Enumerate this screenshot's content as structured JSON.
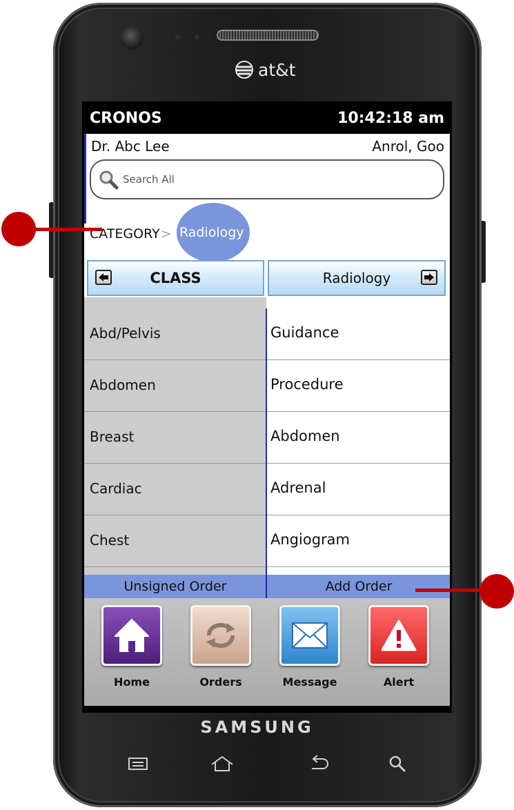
{
  "device": {
    "carrier": "at&t",
    "brand": "SAMSUNG"
  },
  "status_bar": {
    "app_name": "CRONOS",
    "time": "10:42:18 am"
  },
  "header": {
    "doctor": "Dr. Abc Lee",
    "patient": "Anrol, Goo"
  },
  "search": {
    "placeholder": "Search All"
  },
  "breadcrumb": {
    "root": "CATEGORY",
    "separator": ">",
    "current": "Radiology"
  },
  "columns": {
    "left_title": "CLASS",
    "right_title": "Radiology"
  },
  "class_list": [
    "Abd/Pelvis",
    "Abdomen",
    "Breast",
    "Cardiac",
    "Chest"
  ],
  "radiology_list": [
    "Guidance",
    "Procedure",
    "Abdomen",
    "Adrenal",
    "Angiogram"
  ],
  "actions": {
    "unsigned_order": "Unsigned Order",
    "add_order": "Add Order"
  },
  "nav": [
    {
      "label": "Home",
      "icon": "home-icon"
    },
    {
      "label": "Orders",
      "icon": "refresh-icon"
    },
    {
      "label": "Message",
      "icon": "envelope-icon"
    },
    {
      "label": "Alert",
      "icon": "warning-icon"
    }
  ],
  "colors": {
    "accent_blue": "#7a95db",
    "header_gradient": "#b7d9f4",
    "divider_blue": "#1e2bb8",
    "callout_red": "#c00000"
  }
}
